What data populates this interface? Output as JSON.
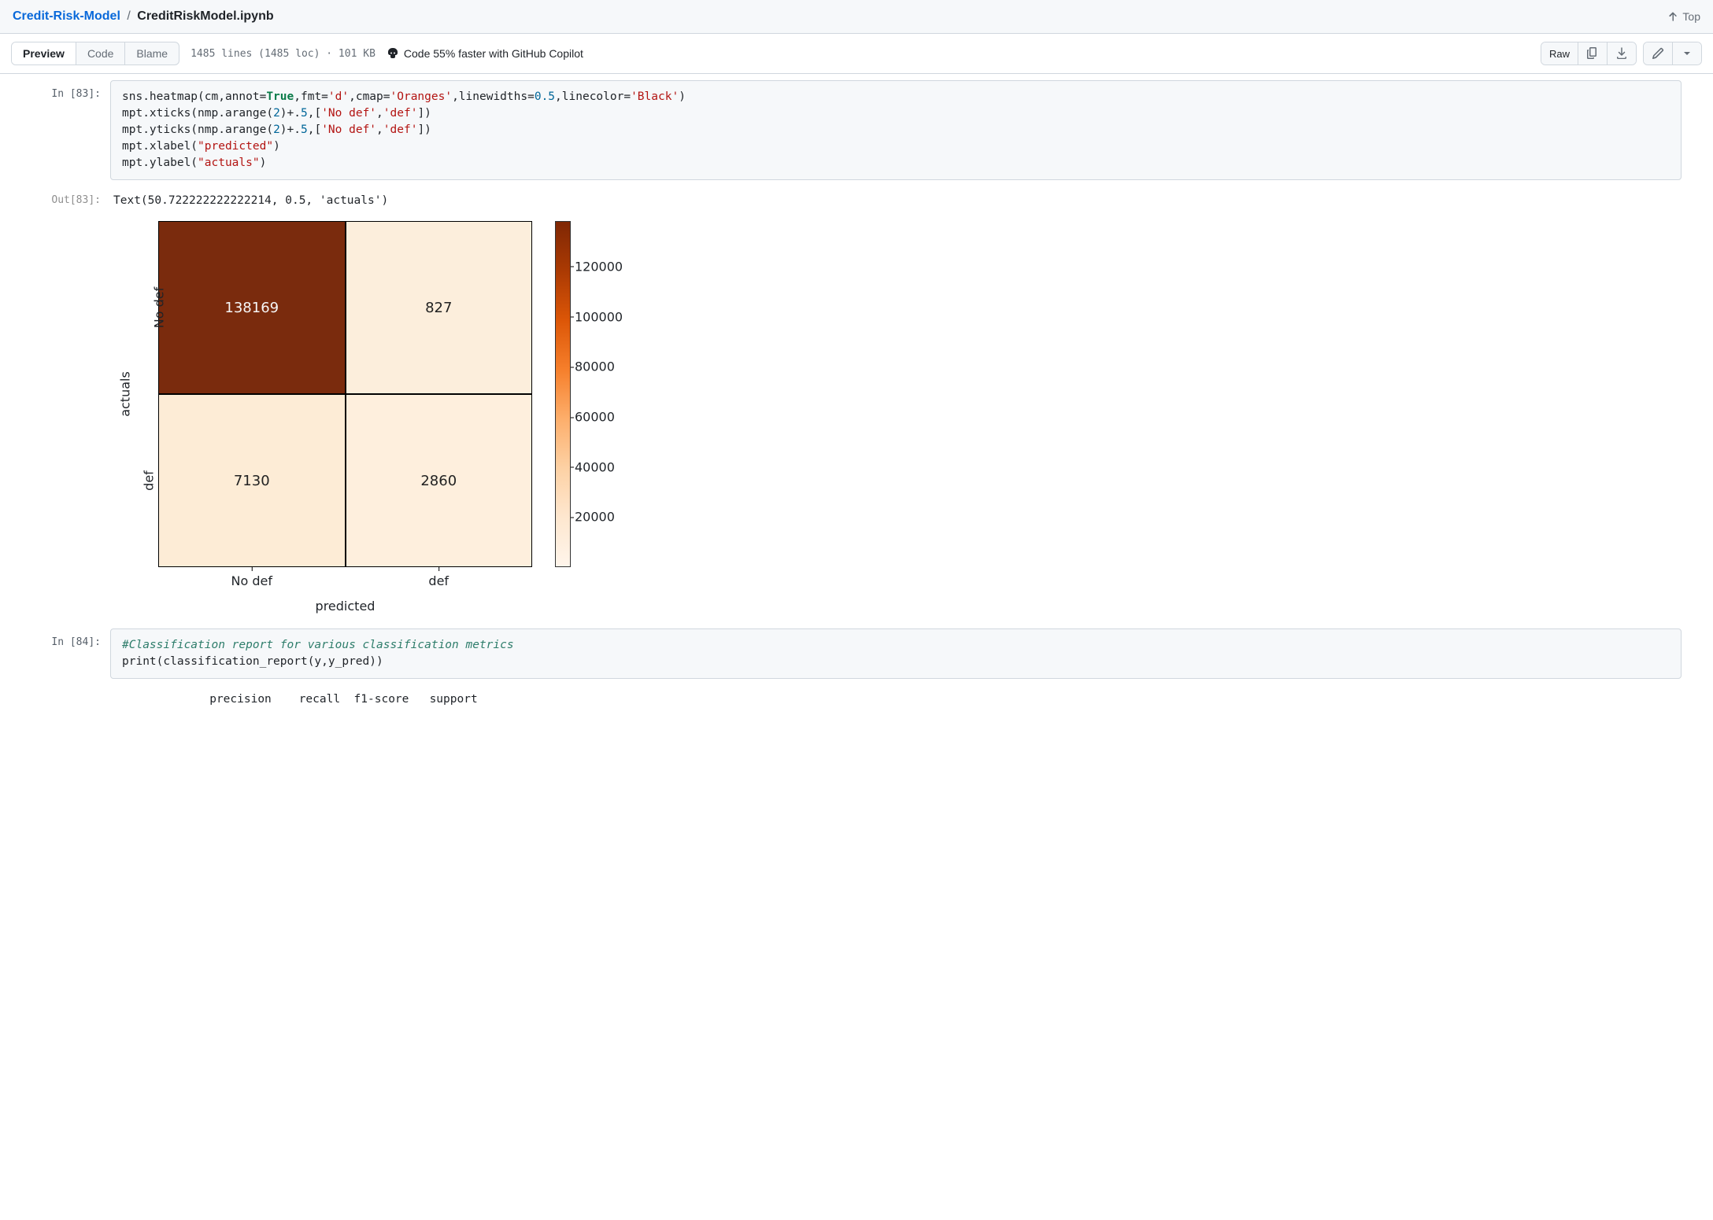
{
  "breadcrumb": {
    "repo": "Credit-Risk-Model",
    "file": "CreditRiskModel.ipynb",
    "top_label": "Top"
  },
  "toolbar": {
    "tabs": [
      "Preview",
      "Code",
      "Blame"
    ],
    "active_tab": "Preview",
    "file_info": "1485 lines (1485 loc) · 101 KB",
    "copilot": "Code 55% faster with GitHub Copilot",
    "raw_label": "Raw"
  },
  "cells": {
    "in83_prompt": "In [83]:",
    "out83_prompt": "Out[83]:",
    "in84_prompt": "In [84]:",
    "out83_text": "Text(50.722222222222214, 0.5, 'actuals')",
    "in83_code": {
      "l1_pre": "sns.heatmap(cm,annot=",
      "l1_true": "True",
      "l1_mid1": ",fmt=",
      "l1_s1": "'d'",
      "l1_mid2": ",cmap=",
      "l1_s2": "'Oranges'",
      "l1_mid3": ",linewidths=",
      "l1_n1": "0.5",
      "l1_mid4": ",linecolor=",
      "l1_s3": "'Black'",
      "l1_end": ")",
      "l2_pre": "mpt.xticks(nmp.arange(",
      "l2_n1": "2",
      "l2_mid": ")+.",
      "l2_n2": "5",
      "l2_mid2": ",[",
      "l2_s1": "'No def'",
      "l2_c": ",",
      "l2_s2": "'def'",
      "l2_end": "])",
      "l3_pre": "mpt.yticks(nmp.arange(",
      "l4_pre": "mpt.xlabel(",
      "l4_s": "\"predicted\"",
      "l4_end": ")",
      "l5_pre": "mpt.ylabel(",
      "l5_s": "\"actuals\"",
      "l5_end": ")"
    },
    "in84_code": {
      "comment": "#Classification report for various classification metrics",
      "l2_pre": "print(classification_report(y,y_pred))"
    },
    "out84_header": "              precision    recall  f1-score   support"
  },
  "chart_data": {
    "type": "heatmap",
    "title": "",
    "xlabel": "predicted",
    "ylabel": "actuals",
    "x_categories": [
      "No def",
      "def"
    ],
    "y_categories": [
      "No def",
      "def"
    ],
    "matrix": [
      [
        138169,
        827
      ],
      [
        7130,
        2860
      ]
    ],
    "cell_colors": [
      [
        "#7a2b0d",
        "#fceedc"
      ],
      [
        "#fdecd6",
        "#feefdd"
      ]
    ],
    "cell_textcolors": [
      [
        "#f6f6f6",
        "#222"
      ],
      [
        "#222",
        "#222"
      ]
    ],
    "colorbar_ticks": [
      20000,
      40000,
      60000,
      80000,
      100000,
      120000
    ],
    "colorbar_range": [
      0,
      138169
    ]
  }
}
